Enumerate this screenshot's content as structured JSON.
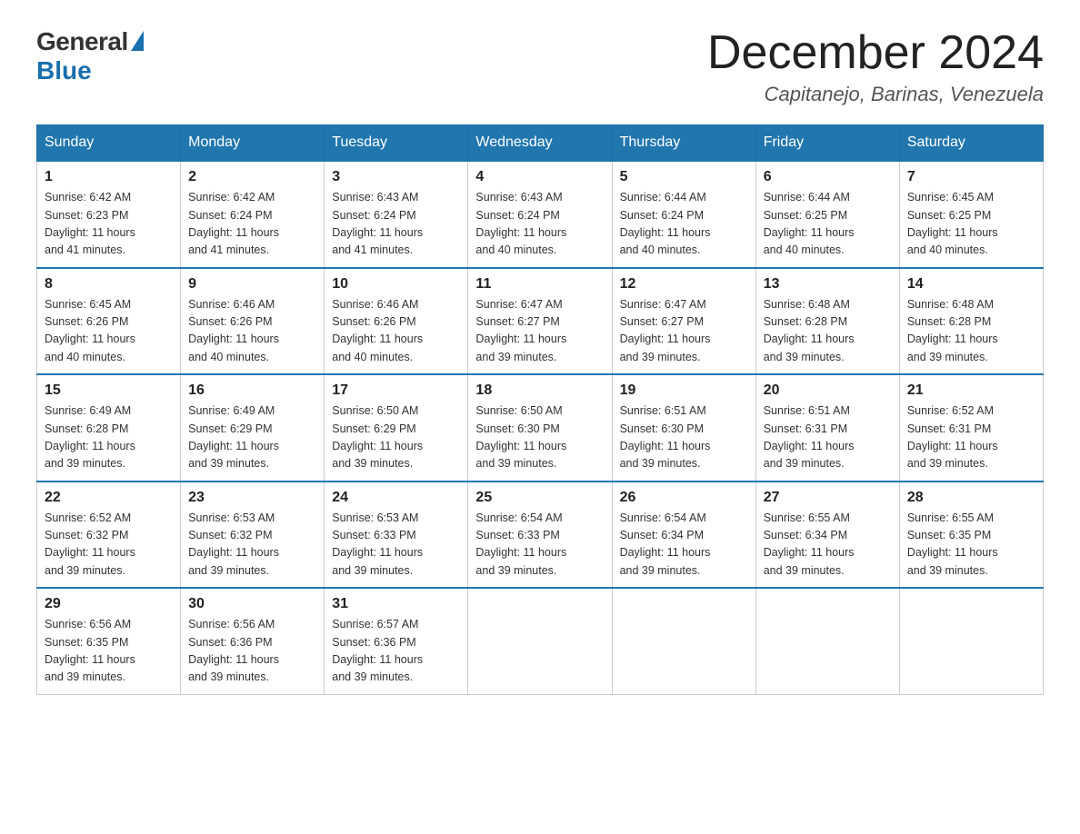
{
  "logo": {
    "general": "General",
    "blue": "Blue"
  },
  "title": "December 2024",
  "location": "Capitanejo, Barinas, Venezuela",
  "days_of_week": [
    "Sunday",
    "Monday",
    "Tuesday",
    "Wednesday",
    "Thursday",
    "Friday",
    "Saturday"
  ],
  "weeks": [
    [
      {
        "day": "1",
        "sunrise": "6:42 AM",
        "sunset": "6:23 PM",
        "daylight": "11 hours and 41 minutes."
      },
      {
        "day": "2",
        "sunrise": "6:42 AM",
        "sunset": "6:24 PM",
        "daylight": "11 hours and 41 minutes."
      },
      {
        "day": "3",
        "sunrise": "6:43 AM",
        "sunset": "6:24 PM",
        "daylight": "11 hours and 41 minutes."
      },
      {
        "day": "4",
        "sunrise": "6:43 AM",
        "sunset": "6:24 PM",
        "daylight": "11 hours and 40 minutes."
      },
      {
        "day": "5",
        "sunrise": "6:44 AM",
        "sunset": "6:24 PM",
        "daylight": "11 hours and 40 minutes."
      },
      {
        "day": "6",
        "sunrise": "6:44 AM",
        "sunset": "6:25 PM",
        "daylight": "11 hours and 40 minutes."
      },
      {
        "day": "7",
        "sunrise": "6:45 AM",
        "sunset": "6:25 PM",
        "daylight": "11 hours and 40 minutes."
      }
    ],
    [
      {
        "day": "8",
        "sunrise": "6:45 AM",
        "sunset": "6:26 PM",
        "daylight": "11 hours and 40 minutes."
      },
      {
        "day": "9",
        "sunrise": "6:46 AM",
        "sunset": "6:26 PM",
        "daylight": "11 hours and 40 minutes."
      },
      {
        "day": "10",
        "sunrise": "6:46 AM",
        "sunset": "6:26 PM",
        "daylight": "11 hours and 40 minutes."
      },
      {
        "day": "11",
        "sunrise": "6:47 AM",
        "sunset": "6:27 PM",
        "daylight": "11 hours and 39 minutes."
      },
      {
        "day": "12",
        "sunrise": "6:47 AM",
        "sunset": "6:27 PM",
        "daylight": "11 hours and 39 minutes."
      },
      {
        "day": "13",
        "sunrise": "6:48 AM",
        "sunset": "6:28 PM",
        "daylight": "11 hours and 39 minutes."
      },
      {
        "day": "14",
        "sunrise": "6:48 AM",
        "sunset": "6:28 PM",
        "daylight": "11 hours and 39 minutes."
      }
    ],
    [
      {
        "day": "15",
        "sunrise": "6:49 AM",
        "sunset": "6:28 PM",
        "daylight": "11 hours and 39 minutes."
      },
      {
        "day": "16",
        "sunrise": "6:49 AM",
        "sunset": "6:29 PM",
        "daylight": "11 hours and 39 minutes."
      },
      {
        "day": "17",
        "sunrise": "6:50 AM",
        "sunset": "6:29 PM",
        "daylight": "11 hours and 39 minutes."
      },
      {
        "day": "18",
        "sunrise": "6:50 AM",
        "sunset": "6:30 PM",
        "daylight": "11 hours and 39 minutes."
      },
      {
        "day": "19",
        "sunrise": "6:51 AM",
        "sunset": "6:30 PM",
        "daylight": "11 hours and 39 minutes."
      },
      {
        "day": "20",
        "sunrise": "6:51 AM",
        "sunset": "6:31 PM",
        "daylight": "11 hours and 39 minutes."
      },
      {
        "day": "21",
        "sunrise": "6:52 AM",
        "sunset": "6:31 PM",
        "daylight": "11 hours and 39 minutes."
      }
    ],
    [
      {
        "day": "22",
        "sunrise": "6:52 AM",
        "sunset": "6:32 PM",
        "daylight": "11 hours and 39 minutes."
      },
      {
        "day": "23",
        "sunrise": "6:53 AM",
        "sunset": "6:32 PM",
        "daylight": "11 hours and 39 minutes."
      },
      {
        "day": "24",
        "sunrise": "6:53 AM",
        "sunset": "6:33 PM",
        "daylight": "11 hours and 39 minutes."
      },
      {
        "day": "25",
        "sunrise": "6:54 AM",
        "sunset": "6:33 PM",
        "daylight": "11 hours and 39 minutes."
      },
      {
        "day": "26",
        "sunrise": "6:54 AM",
        "sunset": "6:34 PM",
        "daylight": "11 hours and 39 minutes."
      },
      {
        "day": "27",
        "sunrise": "6:55 AM",
        "sunset": "6:34 PM",
        "daylight": "11 hours and 39 minutes."
      },
      {
        "day": "28",
        "sunrise": "6:55 AM",
        "sunset": "6:35 PM",
        "daylight": "11 hours and 39 minutes."
      }
    ],
    [
      {
        "day": "29",
        "sunrise": "6:56 AM",
        "sunset": "6:35 PM",
        "daylight": "11 hours and 39 minutes."
      },
      {
        "day": "30",
        "sunrise": "6:56 AM",
        "sunset": "6:36 PM",
        "daylight": "11 hours and 39 minutes."
      },
      {
        "day": "31",
        "sunrise": "6:57 AM",
        "sunset": "6:36 PM",
        "daylight": "11 hours and 39 minutes."
      },
      null,
      null,
      null,
      null
    ]
  ],
  "labels": {
    "sunrise": "Sunrise:",
    "sunset": "Sunset:",
    "daylight": "Daylight:"
  }
}
